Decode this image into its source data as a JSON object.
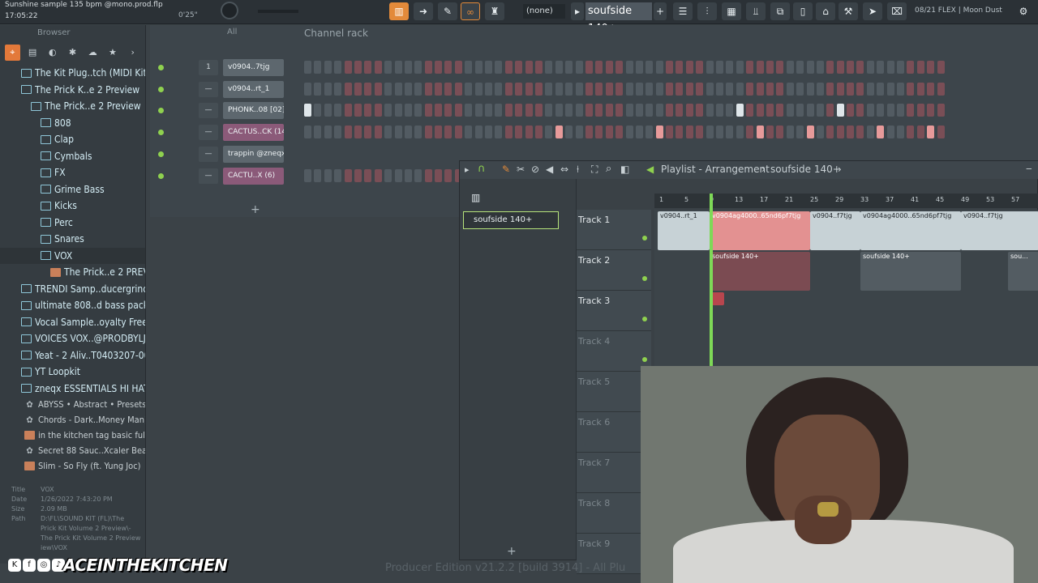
{
  "topbar": {
    "project_title": "Sunshine sample 135 bpm @mono.prod.flp",
    "time": "17:05:22",
    "length": "0'25\"",
    "pattern_none": "(none)",
    "pattern_name": "soufside 140+",
    "hint": "08/21 FLEX | Moon Dust"
  },
  "browser": {
    "title": "Browser",
    "items": [
      {
        "label": "The Kit Plug..tch (MIDI Kit)",
        "indent": 1
      },
      {
        "label": "The Prick K..e 2 Preview",
        "indent": 1
      },
      {
        "label": "The Prick..e 2 Preview",
        "indent": 2
      },
      {
        "label": "808",
        "indent": 3
      },
      {
        "label": "Clap",
        "indent": 3
      },
      {
        "label": "Cymbals",
        "indent": 3
      },
      {
        "label": "FX",
        "indent": 3
      },
      {
        "label": "Grime Bass",
        "indent": 3
      },
      {
        "label": "Kicks",
        "indent": 3
      },
      {
        "label": "Perc",
        "indent": 3
      },
      {
        "label": "Snares",
        "indent": 3
      },
      {
        "label": "VOX",
        "indent": 3
      },
      {
        "label": "The Prick..e 2 PREVIEW",
        "indent": 4
      },
      {
        "label": "TRENDI Samp..ducergrind)",
        "indent": 1
      },
      {
        "label": "ultimate 808..d bass pack",
        "indent": 1
      },
      {
        "label": "Vocal Sample..oyalty Free)",
        "indent": 1
      },
      {
        "label": "VOICES VOX..@PRODBYLJS",
        "indent": 1
      },
      {
        "label": "Yeat - 2 Aliv..T0403207-001",
        "indent": 1
      },
      {
        "label": "YT Loopkit",
        "indent": 1
      },
      {
        "label": "zneqx ESSENTIALS HI HAT",
        "indent": 1
      }
    ],
    "presets": [
      {
        "label": "ABYSS • Abstract • Presets",
        "type": "star"
      },
      {
        "label": "Chords - Dark..Money Man)",
        "type": "star"
      },
      {
        "label": "in the kitchen tag basic full",
        "type": "img"
      },
      {
        "label": "Secret 88 Sauc..Xcaler Beats",
        "type": "star"
      },
      {
        "label": "Slim - So Fly (ft. Yung Joc)",
        "type": "img"
      }
    ],
    "info": {
      "title_k": "Title",
      "title_v": "VOX",
      "date_k": "Date",
      "date_v": "1/26/2022 7:43:20 PM",
      "size_k": "Size",
      "size_v": "2.09 MB",
      "path_k": "Path",
      "path_v1": "D:\\FL\\SOUND KIT (FL)\\The",
      "path_v2": "Prick Kit Volume 2 Preview\\-",
      "path_v3": "The Prick Kit Volume 2 Preview",
      "path_v4": "iew\\VOX"
    }
  },
  "channel_rack": {
    "title": "Channel rack",
    "filter": "All",
    "channels": [
      {
        "num": "1",
        "name": "v0904..7tjg"
      },
      {
        "num": "—",
        "name": "v0904..rt_1"
      },
      {
        "num": "—",
        "name": "PHONK..08 [02]"
      },
      {
        "num": "—",
        "name": "CACTUS..CK (14)"
      },
      {
        "num": "—",
        "name": "trappin @zneqx"
      },
      {
        "num": "—",
        "name": "CACTU..X (6)"
      }
    ]
  },
  "playlist": {
    "title": "Playlist - Arrangement",
    "pattern": "soufside 140+",
    "pattern_item": "soufside 140+",
    "tracks": [
      "Track 1",
      "Track 2",
      "Track 3",
      "Track 4",
      "Track 5",
      "Track 6",
      "Track 7",
      "Track 8",
      "Track 9"
    ],
    "ruler": [
      "1",
      "5",
      "9",
      "13",
      "17",
      "21",
      "25",
      "29",
      "33",
      "37",
      "41",
      "45",
      "49",
      "53",
      "57"
    ],
    "clips": {
      "audio1": "v0904..rt_1",
      "audio2": "v0904ag4000..65nd6pf7tjg",
      "audio3": "v0904..f7tjg",
      "audio4": "v0904ag4000..65nd6pf7tjg",
      "audio5": "v0904..f7tjg",
      "pat1": "soufside 140+",
      "pat2": "soufside 140+",
      "pat3": "sou..."
    }
  },
  "footer": {
    "watermark": "ACEINTHEKITCHEN",
    "producer": "Producer Edition v21.2.2 [build 3914] - All Plu"
  }
}
